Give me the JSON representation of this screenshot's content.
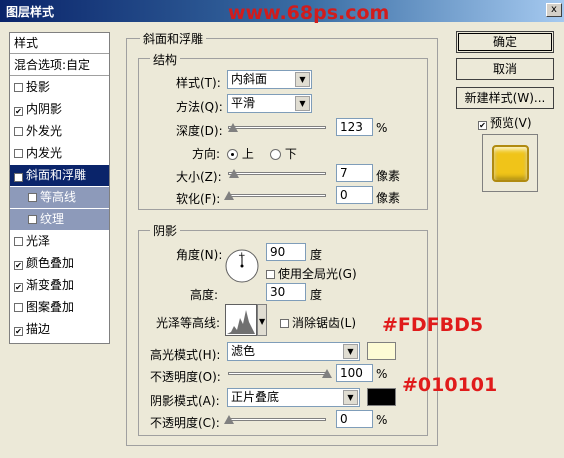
{
  "window": {
    "title": "图层样式",
    "watermark": "www.68ps.com",
    "close_label": "x"
  },
  "left_panel": {
    "header": "样式",
    "blend": "混合选项:自定",
    "items": [
      {
        "label": "投影",
        "checked": false
      },
      {
        "label": "内阴影",
        "checked": true
      },
      {
        "label": "外发光",
        "checked": false
      },
      {
        "label": "内发光",
        "checked": false
      },
      {
        "label": "斜面和浮雕",
        "checked": true
      },
      {
        "label": "等高线",
        "checked": false
      },
      {
        "label": "纹理",
        "checked": false
      },
      {
        "label": "光泽",
        "checked": false
      },
      {
        "label": "颜色叠加",
        "checked": true
      },
      {
        "label": "渐变叠加",
        "checked": true
      },
      {
        "label": "图案叠加",
        "checked": false
      },
      {
        "label": "描边",
        "checked": true
      }
    ]
  },
  "bevel": {
    "title": "斜面和浮雕",
    "structure_title": "结构",
    "style_label": "样式(T):",
    "style_value": "内斜面",
    "technique_label": "方法(Q):",
    "technique_value": "平滑",
    "depth_label": "深度(D):",
    "depth_value": "123",
    "depth_unit": "%",
    "direction_label": "方向:",
    "dir_up": "上",
    "dir_down": "下",
    "size_label": "大小(Z):",
    "size_value": "7",
    "size_unit": "像素",
    "soften_label": "软化(F):",
    "soften_value": "0",
    "soften_unit": "像素"
  },
  "shading": {
    "title": "阴影",
    "angle_label": "角度(N):",
    "angle_value": "90",
    "angle_unit": "度",
    "global_light_label": "使用全局光(G)",
    "altitude_label": "高度:",
    "altitude_value": "30",
    "altitude_unit": "度",
    "gloss_label": "光泽等高线:",
    "antialias_label": "消除锯齿(L)",
    "highlight_mode_label": "高光模式(H):",
    "highlight_mode_value": "滤色",
    "highlight_color": "#FDFBD5",
    "opacity1_label": "不透明度(O):",
    "opacity1_value": "100",
    "shadow_mode_label": "阴影模式(A):",
    "shadow_mode_value": "正片叠底",
    "shadow_color": "#010101",
    "opacity2_label": "不透明度(C):",
    "opacity2_value": "0",
    "percent": "%"
  },
  "annotations": {
    "highlight_hex": "#FDFBD5",
    "shadow_hex": "#010101"
  },
  "right_panel": {
    "ok_label": "确定",
    "cancel_label": "取消",
    "new_style_label": "新建样式(W)...",
    "preview_label": "预览(V)",
    "preview_checked": true
  },
  "colors": {
    "preview_fill": "#f0c419",
    "selected_bg": "#0a246a"
  }
}
